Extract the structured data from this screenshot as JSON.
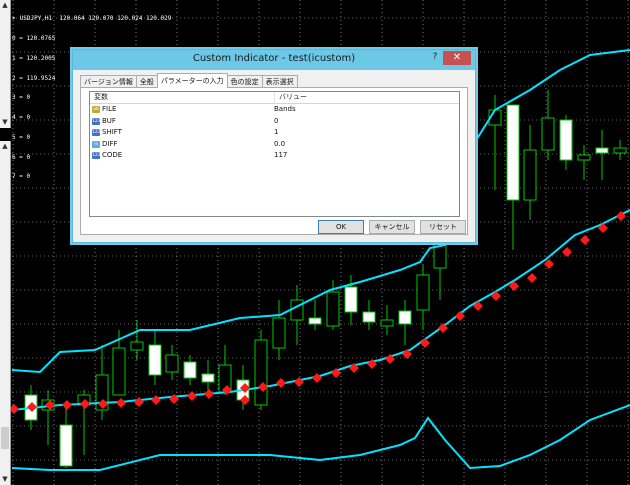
{
  "chart": {
    "info_lines": [
      "USDJPY,H1  120.064 120.070 120.024 120.029",
      "0 = 120.0765",
      "1 = 120.2005",
      "2 = 119.9524",
      "3 = 0",
      "4 = 0",
      "5 = 0",
      "6 = 0",
      "7 = 0"
    ],
    "colors": {
      "band": "#00e5ff",
      "marker": "#ff1a1a",
      "grid": "#c8c8c8",
      "candle": "#00c800"
    }
  },
  "dialog": {
    "title": "Custom Indicator - test(icustom)",
    "help": "?",
    "close": "✕",
    "tabs": [
      "バージョン情報",
      "全般",
      "パラメーターの入力",
      "色の設定",
      "表示選択"
    ],
    "active_tab": "パラメーターの入力",
    "columns": {
      "name": "変数",
      "value": "バリュー"
    },
    "params": [
      {
        "icon": "ab",
        "icon_label": "ab",
        "name": "FILE",
        "value": "Bands"
      },
      {
        "icon": "i123",
        "icon_label": "123",
        "name": "BUF",
        "value": "0"
      },
      {
        "icon": "i123",
        "icon_label": "123",
        "name": "SHIFT",
        "value": "1"
      },
      {
        "icon": "v2",
        "icon_label": "½",
        "name": "DIFF",
        "value": "0.0"
      },
      {
        "icon": "i123",
        "icon_label": "123",
        "name": "CODE",
        "value": "117"
      }
    ],
    "buttons": {
      "ok": "OK",
      "cancel": "キャンセル",
      "reset": "リセット"
    }
  }
}
